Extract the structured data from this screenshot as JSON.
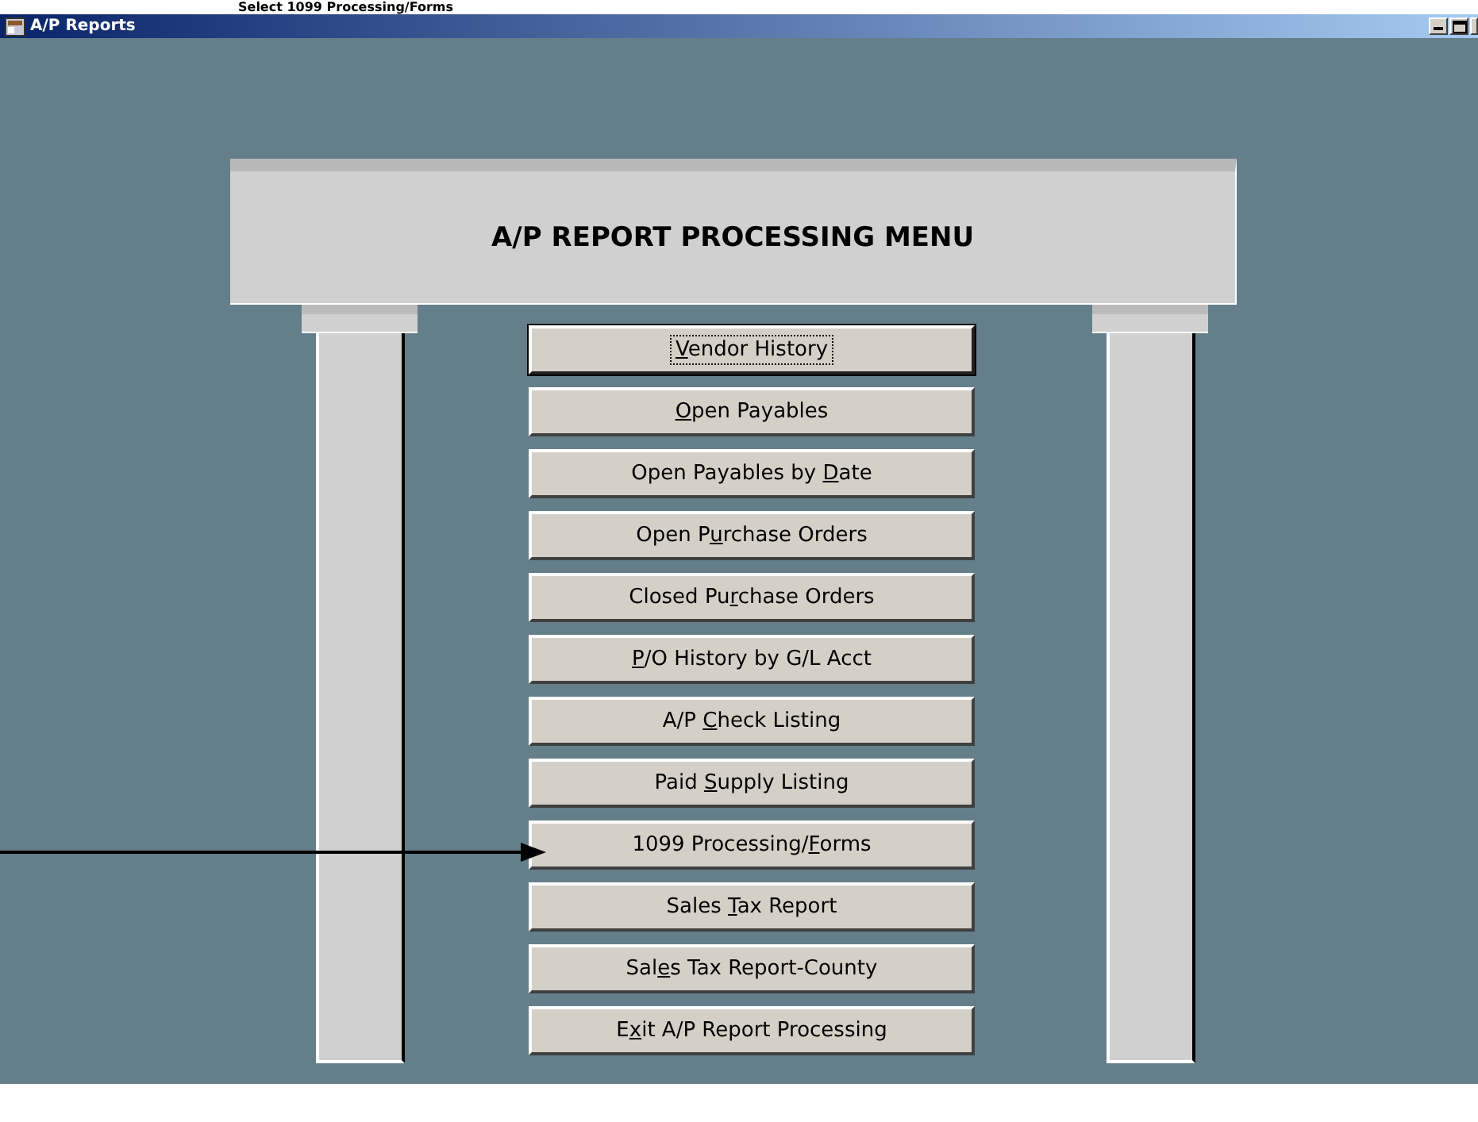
{
  "heading": "Select 1099 Processing/Forms",
  "window": {
    "title": "A/P Reports"
  },
  "menu": {
    "title": "A/P REPORT PROCESSING MENU",
    "buttons": [
      {
        "key": "V",
        "after": "endor History",
        "focused": true
      },
      {
        "key": "O",
        "after": "pen Payables",
        "focused": false
      },
      {
        "before": "Open Payables by ",
        "key": "D",
        "after": "ate",
        "focused": false
      },
      {
        "before": "Open P",
        "key": "u",
        "after": "rchase Orders",
        "focused": false
      },
      {
        "before": "Closed Pu",
        "key": "r",
        "after": "chase Orders",
        "focused": false
      },
      {
        "key": "P",
        "after": "/O History by G/L Acct",
        "focused": false
      },
      {
        "before": "A/P ",
        "key": "C",
        "after": "heck Listing",
        "focused": false
      },
      {
        "before": "Paid ",
        "key": "S",
        "after": "upply Listing",
        "focused": false
      },
      {
        "before": "1099 Processing/",
        "key": "F",
        "after": "orms",
        "focused": false
      },
      {
        "before": "Sales ",
        "key": "T",
        "after": "ax Report",
        "focused": false
      },
      {
        "before": "Sal",
        "key": "e",
        "after": "s Tax Report-County",
        "focused": false
      },
      {
        "before": "E",
        "key": "x",
        "after": "it A/P Report Processing",
        "focused": false
      }
    ]
  }
}
